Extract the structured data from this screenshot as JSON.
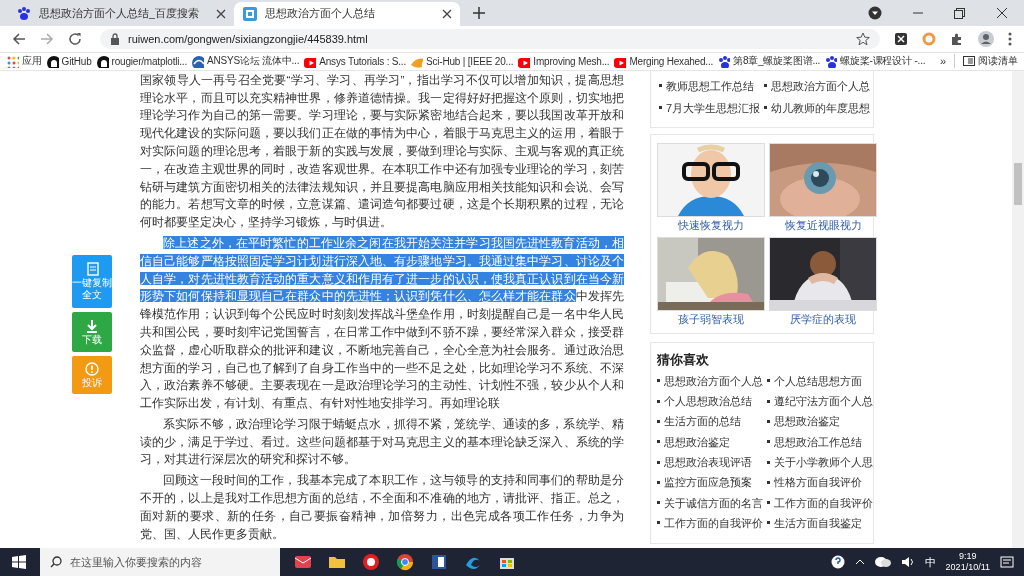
{
  "tabs": [
    {
      "title": "思想政治方面个人总结_百度搜索",
      "kind": "paw",
      "selected": false
    },
    {
      "title": "思想政治方面个人总结",
      "kind": "site",
      "selected": true
    }
  ],
  "address": "ruiwen.com/gongwen/sixiangzongjie/445839.html",
  "bookmarks": [
    {
      "label": "应用",
      "kind": "apps"
    },
    {
      "label": "GitHub",
      "kind": "github"
    },
    {
      "label": "rougier/matplotli...",
      "kind": "github"
    },
    {
      "label": "ANSYS论坛 流体中...",
      "kind": "ansys"
    },
    {
      "label": "Ansys Tutorials : S...",
      "kind": "youtube"
    },
    {
      "label": "Sci-Hub | [IEEE 20...",
      "kind": "scihub"
    },
    {
      "label": "Improving Mesh...",
      "kind": "youtube"
    },
    {
      "label": "Merging Hexahed...",
      "kind": "youtube"
    },
    {
      "label": "第8章_螺旋桨图谱...",
      "kind": "paw"
    },
    {
      "label": "螺旋桨-课程设计 -...",
      "kind": "paw"
    }
  ],
  "bookmarks_overflow": "»",
  "reading_list": "阅读清单",
  "side_buttons": [
    {
      "label": "一键复制",
      "sub": "全文",
      "kind": "copy"
    },
    {
      "label": "下载",
      "kind": "download"
    },
    {
      "label": "投诉",
      "kind": "report"
    }
  ],
  "article": {
    "paragraphs": [
      {
        "indented": false,
        "text": "国家领导人一再号召全党要“学习、学习、再学习”，指出学习不仅可以增加知识，提高思想理论水平，而且可以充实精神世界，修养道德情操。我一定得好好把握这个原则，切实地把理论学习作为自己的第一需要。学习理论，要与实际紧密地结合起来，要以我国改革开放和现代化建设的实际问题，要以我们正在做的事情为中心，着眼于马克思主义的运用，着眼于对实际问题的理论思考，着眼于新的实践与发展，要做到理论与实际、主观与客观的真正统一，在改造主观世界的同时，改造客观世界。在本职工作中还有加强专业理论的学习，刻苦钻研与建筑方面密切相关的法律法规知识，并且要提高电脑应用相关技能知识和会说、会写的能力。若想写文章的时候，立意谋篇、遣词造句都要过硬，这是个长期积累的过程，无论何时都要坚定决心，坚持学习锻炼，与时俱进。"
      },
      {
        "indented": true,
        "selected_text": "除上述之外，在平时繁忙的工作业余之闲在我开始关注并学习我国先进性教育活动，相信自己能够严格按照固定学习计划进行深入地、有步骤地学习。我通过集中学习、讨论及个人自学，对先进性教育活动的重大意义和作用有了进一步的认识，使我真正认识到在当今新形势下如何保持和显现自己在群众中的先进性；认识到凭什么、怎么样才能在群众",
        "text": "中发挥先锋模范作用；认识到每个公民应时时刻刻发挥战斗堡垒作用，时刻提醒自己是一名中华人民共和国公民，要时刻牢记党国誓言，在日常工作中做到不骄不躁，要经常深入群众，接受群众监督，虚心听取群众的批评和建议，不断地完善自己，全心全意为社会服务。通过政治思想方面的学习，自己也了解到了自身工作当中的一些不足之处，比如理论学习不系统、不深入，政治素养不够硬。主要表现在一是政治理论学习的主动性、计划性不强，较少从个人和工作实际出发，有计划、有重点、有针对性地安排学习。再如理论联"
      },
      {
        "indented": true,
        "text": "系实际不够，政治理论学习限于蜻蜓点水，抓得不紧，笼统学、通读的多，系统学、精读的少，满足于学过、看过。这些问题都基于对马克思主义的基本理论缺乏深入、系统的学习，对其进行深层次的研究和探讨不够。"
      },
      {
        "indented": true,
        "text": "回顾这一段时间的工作，我基本完成了本职工作，这与领导的支持和同事们的帮助是分不开的，以上是我对工作思想方面的总结，不全面和不准确的地方，请批评、指正。总之，面对新的要求、新的任务，自己要振奋精神，加倍努力，出色完成各项工作任务，力争为党、国、人民作更多贡献。"
      }
    ]
  },
  "sidebar": {
    "related": [
      "教师思想工作总结",
      "思想政治方面个人总",
      "7月大学生思想汇报",
      "幼儿教师的年度思想"
    ],
    "ads": [
      {
        "caption": "快速恢复视力",
        "kind": "picture"
      },
      {
        "caption": "恢复近视眼视力",
        "kind": "picture"
      },
      {
        "caption": "孩子弱智表现",
        "kind": "picture"
      },
      {
        "caption": "厌学症的表现",
        "kind": "picture"
      }
    ],
    "guess": {
      "title": "猜你喜欢",
      "items": [
        "思想政治方面个人总",
        "个人总结思想方面",
        "个人思想政治总结",
        "遵纪守法方面个人总",
        "生活方面的总结",
        "思想政治鉴定",
        "思想政治鉴定",
        "思想政治工作总结",
        "思想政治表现评语",
        "关于小学教师个人思",
        "监控方面应急预案",
        "性格方面自我评价",
        "关于诚信方面的名言",
        "工作方面的自我评价",
        "工作方面的自我评价",
        "生活方面自我鉴定"
      ]
    }
  },
  "taskbar": {
    "search_placeholder": "在这里输入你要搜索的内容",
    "ime": "中",
    "time": "9:19",
    "date": "2021/10/11"
  }
}
